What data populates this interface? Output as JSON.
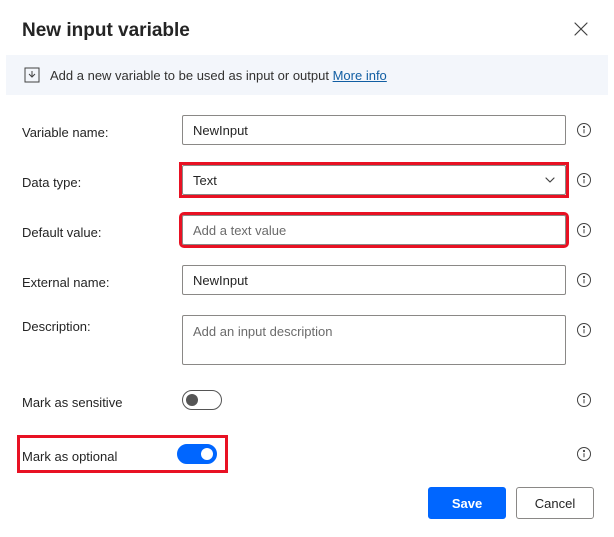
{
  "header": {
    "title": "New input variable"
  },
  "banner": {
    "text": "Add a new variable to be used as input or output ",
    "link_text": "More info"
  },
  "form": {
    "variable_name": {
      "label": "Variable name:",
      "value": "NewInput"
    },
    "data_type": {
      "label": "Data type:",
      "value": "Text"
    },
    "default_value": {
      "label": "Default value:",
      "placeholder": "Add a text value"
    },
    "external_name": {
      "label": "External name:",
      "value": "NewInput"
    },
    "description": {
      "label": "Description:",
      "placeholder": "Add an input description"
    },
    "mark_sensitive": {
      "label": "Mark as sensitive"
    },
    "mark_optional": {
      "label": "Mark as optional"
    }
  },
  "footer": {
    "save": "Save",
    "cancel": "Cancel"
  }
}
